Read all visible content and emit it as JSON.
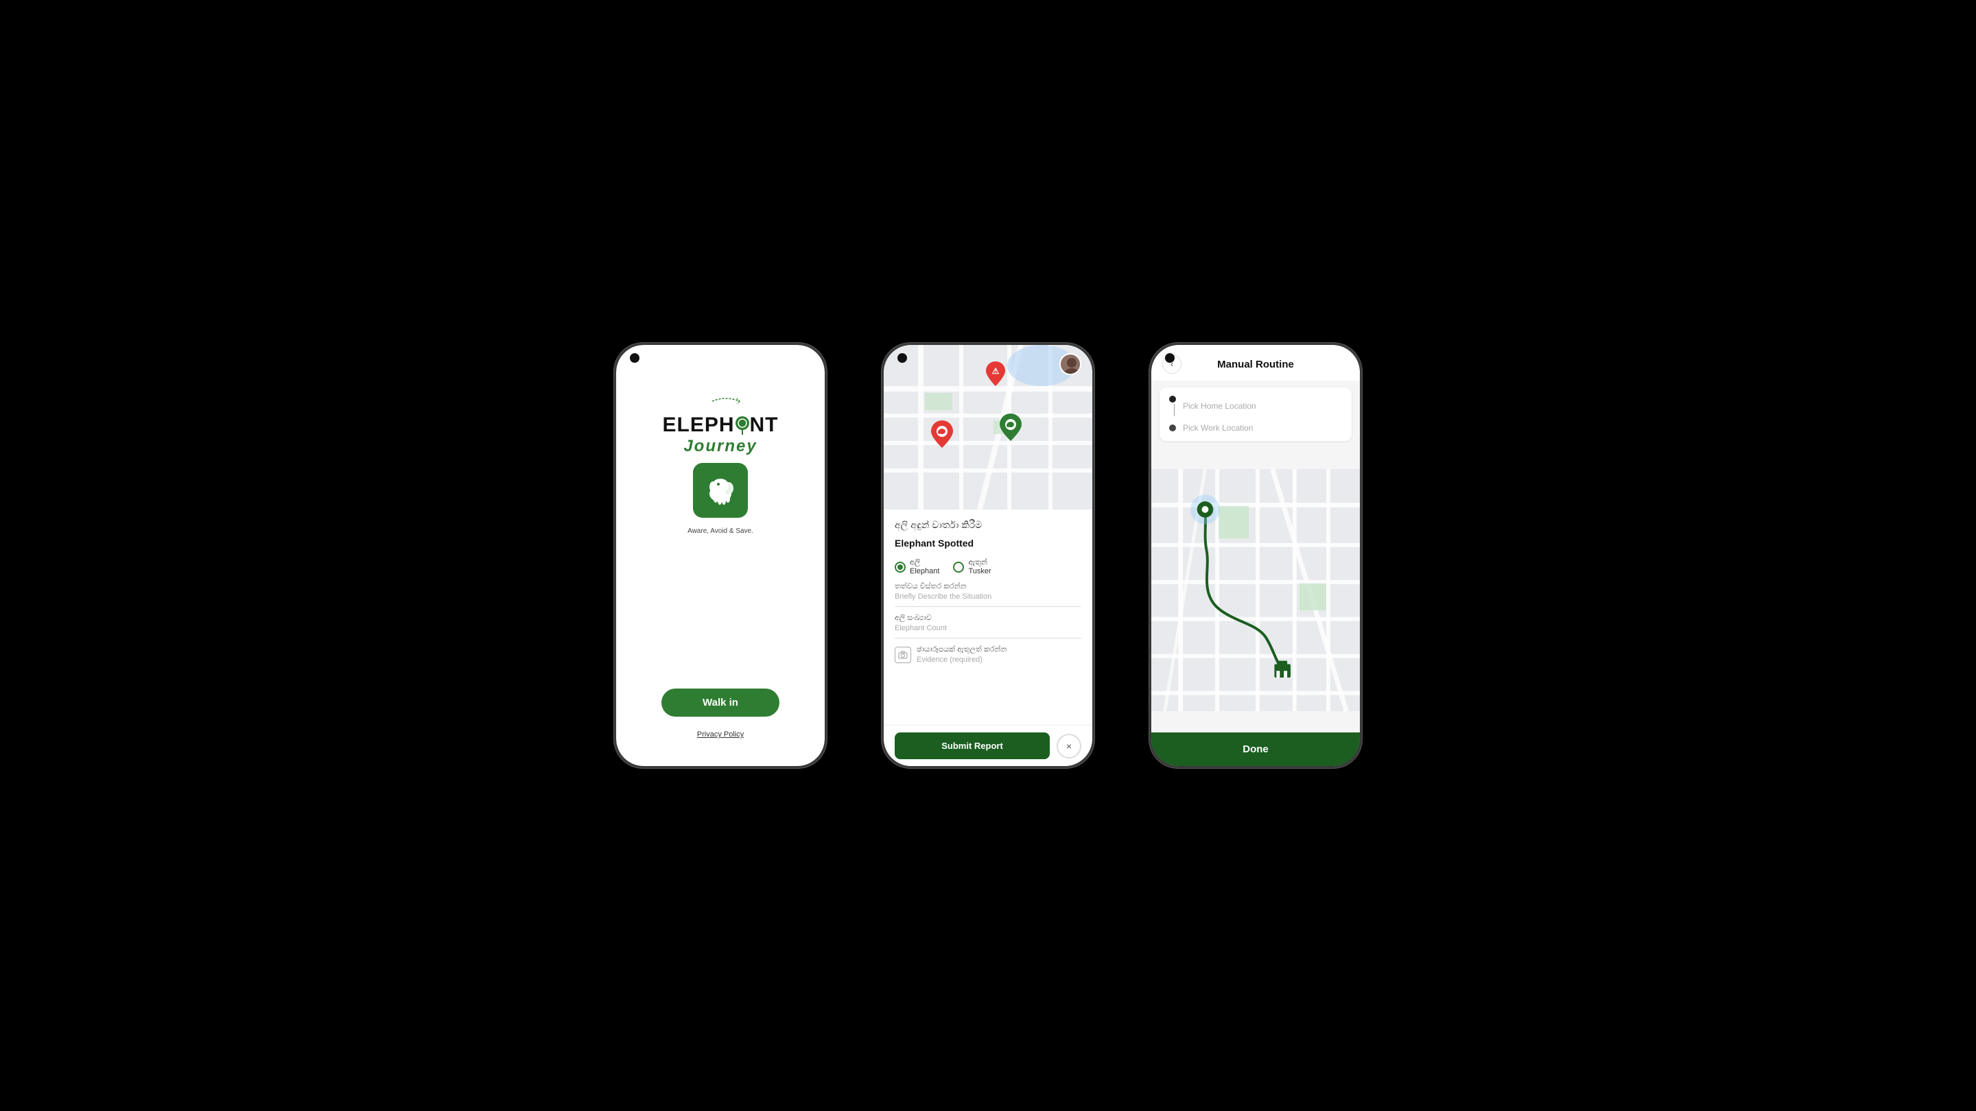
{
  "phone1": {
    "logo_elephant": "ELEPH",
    "logo_O_replaced": "NT",
    "logo_journey": "Journey",
    "tagline": "Aware, Avoid & Save.",
    "walk_in_label": "Walk in",
    "privacy_label": "Privacy Policy"
  },
  "phone2": {
    "title_sinhala": "අලි අඳුන් වාර්තා කිරීම",
    "title_english": "Elephant Spotted",
    "radio_elephant_sinhala": "අලි",
    "radio_elephant_english": "Elephant",
    "radio_tusker_sinhala": "ඇතුන්",
    "radio_tusker_english": "Tusker",
    "situation_label_sinhala": "තත්වය විස්තර කරන්න",
    "situation_placeholder": "Briefly Describe the Situation",
    "count_label_sinhala": "අලි සංඛ්‍යාව",
    "count_placeholder": "Elephant Count",
    "evidence_label_sinhala": "ඡායාරූපයක් ඇතුලත් කරන්න",
    "evidence_placeholder": "Evidence (required)",
    "submit_label": "Submit Report",
    "close_label": "×"
  },
  "phone3": {
    "header_title": "Manual Routine",
    "back_label": "‹",
    "pick_home": "Pick Home Location",
    "pick_work": "Pick Work Location",
    "done_label": "Done"
  }
}
